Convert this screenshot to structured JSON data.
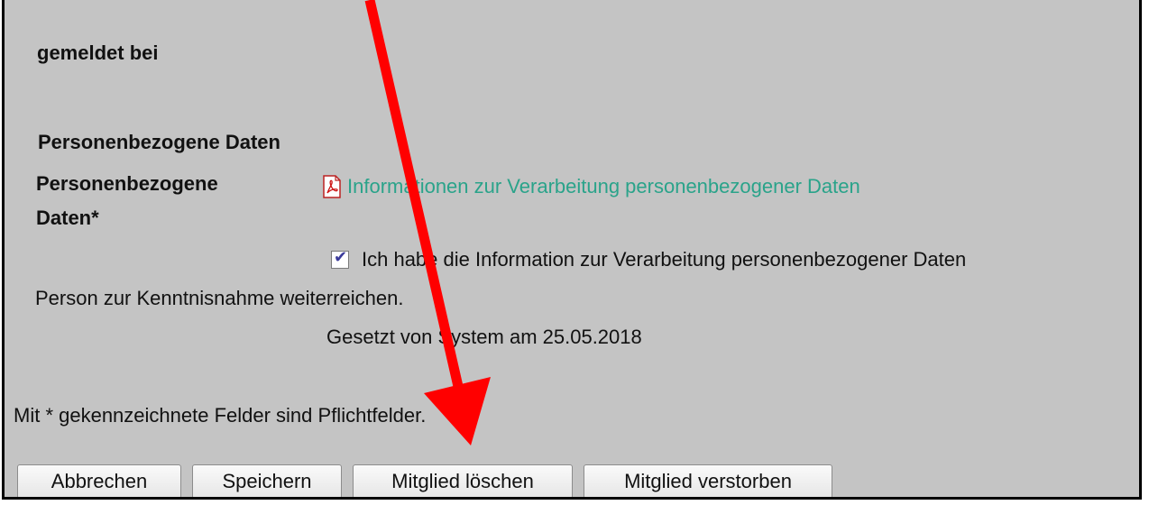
{
  "form": {
    "reported_at_label": "gemeldet bei",
    "section_title": "Personenbezogene Daten",
    "field_label_line1": "Personenbezogene",
    "field_label_line2": "Daten*",
    "pdf_link_text": "Informationen zur Verarbeitung personenbezogener Daten",
    "consent_checked": true,
    "consent_text_line1": "Ich habe die Information zur Verarbeitung personenbezogener Daten",
    "consent_text_line2": "Person zur Kenntnisnahme weiterreichen.",
    "set_by_text": "Gesetzt von System am 25.05.2018",
    "required_note": "Mit * gekennzeichnete Felder sind Pflichtfelder."
  },
  "buttons": {
    "cancel": "Abbrechen",
    "save": "Speichern",
    "delete_member": "Mitglied löschen",
    "member_deceased": "Mitglied verstorben"
  },
  "icons": {
    "pdf": "pdf-icon",
    "checkbox_tick": "check-icon"
  },
  "colors": {
    "panel_bg": "#c4c4c4",
    "link": "#2aa38a",
    "annotation_arrow": "#ff0000"
  }
}
